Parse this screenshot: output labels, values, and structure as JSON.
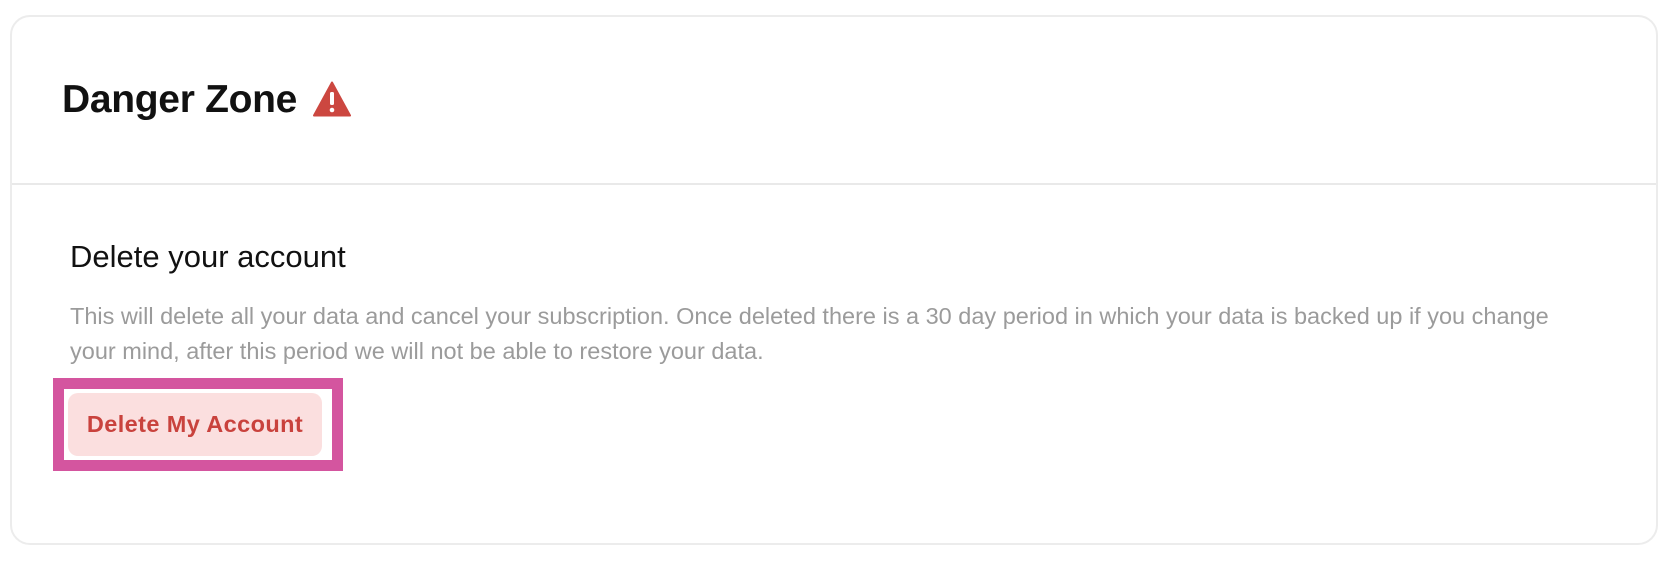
{
  "header": {
    "title": "Danger Zone",
    "icon": "warning-icon",
    "icon_color": "#cc4740"
  },
  "section": {
    "title": "Delete your account",
    "description": "This will delete all your data and cancel your subscription. Once deleted there is a 30 day period in which your data is backed up if you change your mind, after this period we will not be able to restore your data."
  },
  "actions": {
    "delete_label": "Delete My Account"
  },
  "colors": {
    "danger_text": "#c9423d",
    "danger_bg": "#fbdfdf",
    "highlight": "#d4559f"
  }
}
